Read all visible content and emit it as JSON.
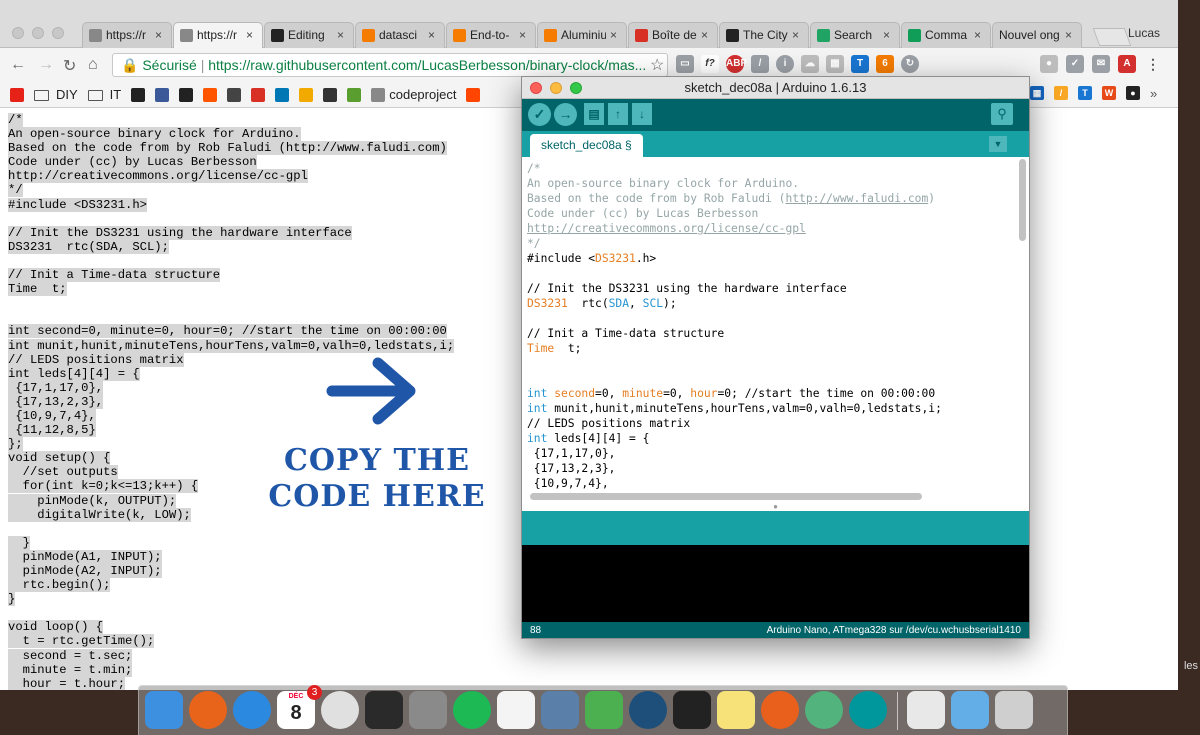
{
  "browser": {
    "tabs": [
      {
        "title": "https://r",
        "icon": "page-icon",
        "color": "#888888"
      },
      {
        "title": "https://r",
        "icon": "page-icon",
        "color": "#888888"
      },
      {
        "title": "Editing",
        "icon": "github-icon",
        "color": "#222222"
      },
      {
        "title": "datasci",
        "icon": "loading-icon",
        "color": "#f57c00"
      },
      {
        "title": "End-to-",
        "icon": "blogger-icon",
        "color": "#f57c00"
      },
      {
        "title": "Aluminiu",
        "icon": "blogger-icon",
        "color": "#f57c00"
      },
      {
        "title": "Boîte de",
        "icon": "gmail-icon",
        "color": "#d93025"
      },
      {
        "title": "The City",
        "icon": "kaggle-icon",
        "color": "#222222"
      },
      {
        "title": "Search",
        "icon": "drive-icon",
        "color": "#1fa463"
      },
      {
        "title": "Comma",
        "icon": "sheets-icon",
        "color": "#0f9d58"
      },
      {
        "title": "Nouvel ong",
        "icon": "",
        "color": ""
      }
    ],
    "profile_name": "Lucas",
    "secure_label": "Sécurisé",
    "url": "https://raw.githubusercontent.com/LucasBerbesson/binary-clock/mas...",
    "bookmarks": [
      {
        "label": "",
        "icon": "youtube-icon",
        "color": "#e62117"
      },
      {
        "label": "DIY",
        "icon": "folder-icon",
        "color": ""
      },
      {
        "label": "IT",
        "icon": "folder-icon",
        "color": ""
      },
      {
        "label": "",
        "icon": "imdb-icon",
        "color": "#222222"
      },
      {
        "label": "",
        "icon": "facebook-icon",
        "color": "#3b5998"
      },
      {
        "label": "",
        "icon": "star-icon",
        "color": "#222222"
      },
      {
        "label": "",
        "icon": "soundcloud-icon",
        "color": "#ff5500"
      },
      {
        "label": "",
        "icon": "camera-icon",
        "color": "#444444"
      },
      {
        "label": "",
        "icon": "gmail-icon",
        "color": "#d93025"
      },
      {
        "label": "",
        "icon": "linkedin-icon",
        "color": "#0077b5"
      },
      {
        "label": "",
        "icon": "chart-icon",
        "color": "#f2a900"
      },
      {
        "label": "",
        "icon": "analytics-icon",
        "color": "#333333"
      },
      {
        "label": "",
        "icon": "plant-icon",
        "color": "#5a9e2f"
      },
      {
        "label": "codeproject",
        "icon": "page-icon",
        "color": "#888888"
      },
      {
        "label": "",
        "icon": "reddit-icon",
        "color": "#ff4500"
      }
    ],
    "raw_lines": [
      "/*",
      "An open-source binary clock for Arduino.",
      "Based on the code from by Rob Faludi (http://www.faludi.com)",
      "Code under (cc) by Lucas Berbesson",
      "http://creativecommons.org/license/cc-gpl",
      "*/",
      "#include <DS3231.h>",
      "",
      "// Init the DS3231 using the hardware interface",
      "DS3231  rtc(SDA, SCL);",
      "",
      "// Init a Time-data structure",
      "Time  t;",
      "",
      "",
      "int second=0, minute=0, hour=0; //start the time on 00:00:00",
      "int munit,hunit,minuteTens,hourTens,valm=0,valh=0,ledstats,i;",
      "// LEDS positions matrix",
      "int leds[4][4] = {",
      " {17,1,17,0},",
      " {17,13,2,3},",
      " {10,9,7,4},",
      " {11,12,8,5}",
      "};",
      "void setup() {",
      "  //set outputs",
      "  for(int k=0;k<=13;k++) {",
      "    pinMode(k, OUTPUT);",
      "    digitalWrite(k, LOW);",
      "",
      "  }",
      "  pinMode(A1, INPUT);",
      "  pinMode(A2, INPUT);",
      "  rtc.begin();",
      "}",
      "",
      "void loop() {",
      "  t = rtc.getTime();",
      "  second = t.sec;",
      "  minute = t.min;",
      "  hour = t.hour;"
    ]
  },
  "overlay": {
    "line1": "COPY THE",
    "line2": "CODE HERE",
    "color": "#1f56a8"
  },
  "arduino": {
    "title": "sketch_dec08a | Arduino 1.6.13",
    "tab_label": "sketch_dec08a §",
    "code_lines": [
      [
        {
          "t": "/*",
          "c": "comment"
        }
      ],
      [
        {
          "t": "An open-source binary clock for Arduino.",
          "c": "comment"
        }
      ],
      [
        {
          "t": "Based on the code from by Rob Faludi (",
          "c": "comment"
        },
        {
          "t": "http://www.faludi.com",
          "c": "link"
        },
        {
          "t": ")",
          "c": "comment"
        }
      ],
      [
        {
          "t": "Code under (cc) by Lucas Berbesson",
          "c": "comment"
        }
      ],
      [
        {
          "t": "http://creativecommons.org/license/cc-gpl",
          "c": "link"
        }
      ],
      [
        {
          "t": "*/",
          "c": "comment"
        }
      ],
      [
        {
          "t": "#include <",
          "c": "plain"
        },
        {
          "t": "DS3231",
          "c": "type"
        },
        {
          "t": ".h>",
          "c": "plain"
        }
      ],
      [],
      [
        {
          "t": "// Init the DS3231 using the hardware interface",
          "c": "plain"
        }
      ],
      [
        {
          "t": "DS3231",
          "c": "type"
        },
        {
          "t": "  rtc(",
          "c": "plain"
        },
        {
          "t": "SDA",
          "c": "const"
        },
        {
          "t": ", ",
          "c": "plain"
        },
        {
          "t": "SCL",
          "c": "const"
        },
        {
          "t": ");",
          "c": "plain"
        }
      ],
      [],
      [
        {
          "t": "// Init a Time-data structure",
          "c": "plain"
        }
      ],
      [
        {
          "t": "Time",
          "c": "type"
        },
        {
          "t": "  t;",
          "c": "plain"
        }
      ],
      [],
      [],
      [
        {
          "t": "int",
          "c": "const"
        },
        {
          "t": " ",
          "c": "plain"
        },
        {
          "t": "second",
          "c": "type"
        },
        {
          "t": "=0, ",
          "c": "plain"
        },
        {
          "t": "minute",
          "c": "type"
        },
        {
          "t": "=0, ",
          "c": "plain"
        },
        {
          "t": "hour",
          "c": "type"
        },
        {
          "t": "=0; //start the time on 00:00:00",
          "c": "plain"
        }
      ],
      [
        {
          "t": "int",
          "c": "const"
        },
        {
          "t": " munit,hunit,minuteTens,hourTens,valm=0,valh=0,ledstats,i;",
          "c": "plain"
        }
      ],
      [
        {
          "t": "// LEDS positions matrix",
          "c": "plain"
        }
      ],
      [
        {
          "t": "int",
          "c": "const"
        },
        {
          "t": " leds[4][4] = {",
          "c": "plain"
        }
      ],
      [
        {
          "t": " {17,1,17,0},",
          "c": "plain"
        }
      ],
      [
        {
          "t": " {17,13,2,3},",
          "c": "plain"
        }
      ],
      [
        {
          "t": " {10,9,7,4},",
          "c": "plain"
        }
      ]
    ],
    "line_number": "88",
    "board_info": "Arduino Nano, ATmega328 sur /dev/cu.wchusbserial1410",
    "colors": {
      "dark_teal": "#006468",
      "teal": "#17a1a5",
      "button": "#4db7bb"
    }
  },
  "side_snippet": "les",
  "dock": {
    "calendar_month": "DÉC",
    "calendar_day": "8",
    "calendar_badge": "3",
    "apps": [
      {
        "name": "finder-icon",
        "color": "#3d8fe0"
      },
      {
        "name": "firefox-icon",
        "color": "#e8641b"
      },
      {
        "name": "safari-icon",
        "color": "#2b8ae0"
      },
      {
        "name": "calendar-icon",
        "color": "#ffffff"
      },
      {
        "name": "chrome-icon",
        "color": "#e0e0e0"
      },
      {
        "name": "terminal-icon",
        "color": "#2a2a2a"
      },
      {
        "name": "system-preferences-icon",
        "color": "#8a8a8a"
      },
      {
        "name": "spotify-icon",
        "color": "#1db954"
      },
      {
        "name": "slack-icon",
        "color": "#f4f4f4"
      },
      {
        "name": "preview-icon",
        "color": "#5a7fa8"
      },
      {
        "name": "xcode-cross-icon",
        "color": "#4caf50"
      },
      {
        "name": "sourcetree-icon",
        "color": "#1e4f7a"
      },
      {
        "name": "pycharm-icon",
        "color": "#222222"
      },
      {
        "name": "notes-icon",
        "color": "#f7e27a"
      },
      {
        "name": "sketch-pen-icon",
        "color": "#e8601c"
      },
      {
        "name": "atom-icon",
        "color": "#53b37d"
      },
      {
        "name": "arduino-icon",
        "color": "#00979c"
      },
      {
        "name": "png-file-icon",
        "color": "#e8e8e8"
      },
      {
        "name": "folder-icon",
        "color": "#64aee8"
      },
      {
        "name": "trash-icon",
        "color": "#cfcfcf"
      }
    ]
  }
}
